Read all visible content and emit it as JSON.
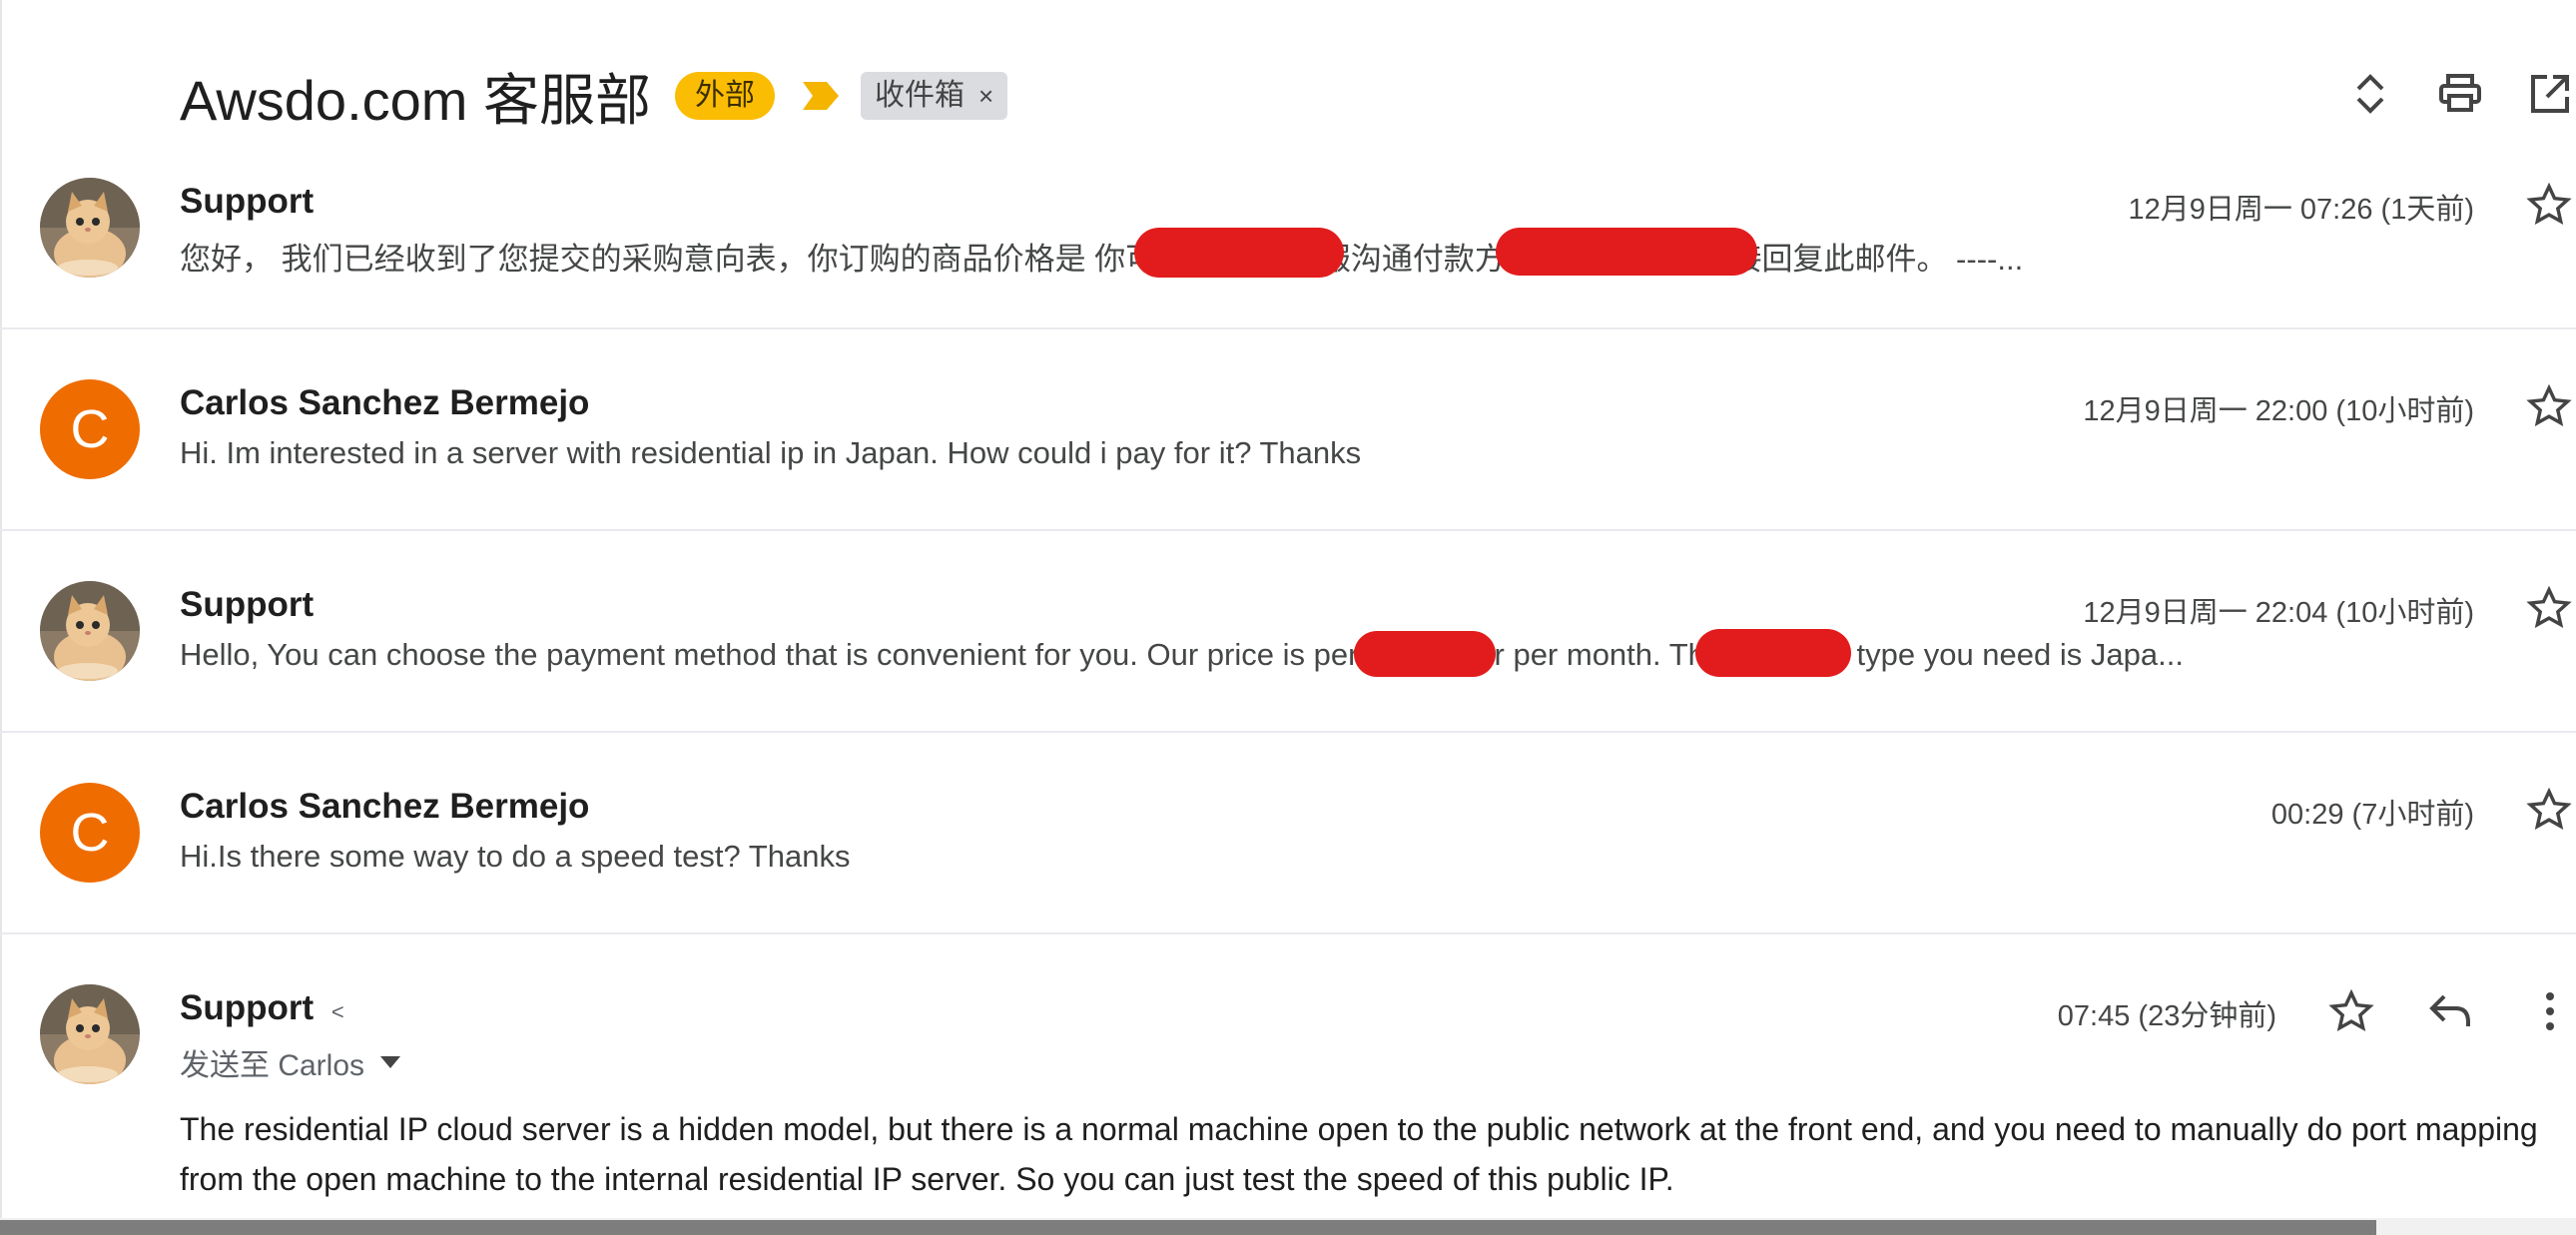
{
  "header": {
    "subject": "Awsdo.com 客服部",
    "external_badge": "外部",
    "inbox_label": "收件箱",
    "remove_label_glyph": "×"
  },
  "icons": [
    "expand-all-icon",
    "print-icon",
    "open-in-new-window-icon",
    "star-icon",
    "reply-icon",
    "more-vert-icon",
    "importance-marker-icon"
  ],
  "messages": [
    {
      "sender": "Support",
      "avatar": "cat-photo",
      "date": "12月9日周一 07:26 (1天前)",
      "snippet": "您好， 我们已经收到了您提交的采购意向表，你订购的商品价格是                    你可以添加                           和客服沟通付款方式。 你也可以直接回复此邮件。 ----..."
    },
    {
      "sender": "Carlos Sanchez Bermejo",
      "avatar_letter": "C",
      "date": "12月9日周一 22:00 (10小时前)",
      "snippet": "Hi. Im interested in a server with residential ip in Japan. How could i pay for it? Thanks"
    },
    {
      "sender": "Support",
      "avatar": "cat-photo",
      "date": "12月9日周一 22:04 (10小时前)",
      "snippet": "Hello, You can choose the payment method that is convenient for you. Our price is              per month. Or              per month. The machine type you need is Japa..."
    },
    {
      "sender": "Carlos Sanchez Bermejo",
      "avatar_letter": "C",
      "date": "00:29 (7小时前)",
      "snippet": "Hi.Is there some way to do a speed test? Thanks"
    }
  ],
  "expanded_message": {
    "sender": "Support",
    "sender_extra": "<",
    "send_to": "发送至 Carlos",
    "date": "07:45 (23分钟前)",
    "body_line1": "The residential IP cloud server is a hidden model, but there is a normal machine open to the public network at the front end, and you need to manually do port mapping",
    "body_line2": "from the open machine to the internal residential IP server. So you can just test the speed of this public IP."
  },
  "colors": {
    "external_badge": "#fbbc04",
    "avatar_orange": "#ef6c00",
    "redaction": "#e21c1c",
    "divider": "#e8eaed"
  }
}
